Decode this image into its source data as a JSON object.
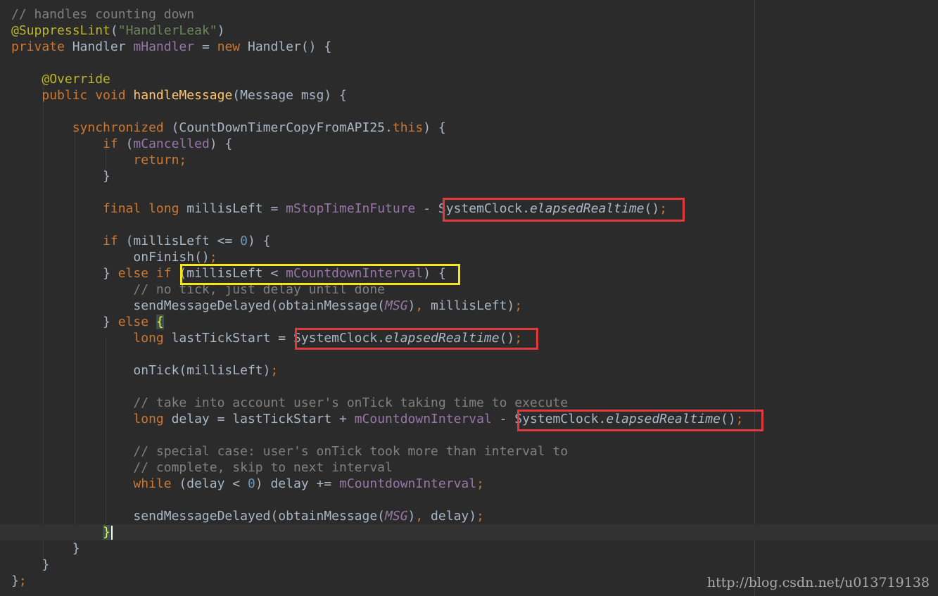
{
  "code_lines": [
    [
      {
        "t": "// handles counting down",
        "c": "comment"
      }
    ],
    [
      {
        "t": "@SuppressLint",
        "c": "annotation"
      },
      {
        "t": "(",
        "c": "plain"
      },
      {
        "t": "\"HandlerLeak\"",
        "c": "string"
      },
      {
        "t": ")",
        "c": "plain"
      }
    ],
    [
      {
        "t": "private",
        "c": "keyword"
      },
      {
        "t": " Handler ",
        "c": "plain"
      },
      {
        "t": "mHandler",
        "c": "field"
      },
      {
        "t": " = ",
        "c": "plain"
      },
      {
        "t": "new",
        "c": "keyword"
      },
      {
        "t": " Handler() {",
        "c": "plain"
      }
    ],
    [],
    [
      {
        "t": "    ",
        "c": "plain"
      },
      {
        "t": "@Override",
        "c": "annotation"
      }
    ],
    [
      {
        "t": "    ",
        "c": "plain"
      },
      {
        "t": "public void ",
        "c": "keyword"
      },
      {
        "t": "handleMessage",
        "c": "method"
      },
      {
        "t": "(Message msg) {",
        "c": "plain"
      }
    ],
    [],
    [
      {
        "t": "        ",
        "c": "plain"
      },
      {
        "t": "synchronized",
        "c": "keyword"
      },
      {
        "t": " (CountDownTimerCopyFromAPI25.",
        "c": "plain"
      },
      {
        "t": "this",
        "c": "keyword"
      },
      {
        "t": ") {",
        "c": "plain"
      }
    ],
    [
      {
        "t": "            ",
        "c": "plain"
      },
      {
        "t": "if",
        "c": "keyword"
      },
      {
        "t": " (",
        "c": "plain"
      },
      {
        "t": "mCancelled",
        "c": "field"
      },
      {
        "t": ") {",
        "c": "plain"
      }
    ],
    [
      {
        "t": "                ",
        "c": "plain"
      },
      {
        "t": "return;",
        "c": "keyword"
      }
    ],
    [
      {
        "t": "            }",
        "c": "plain"
      }
    ],
    [],
    [
      {
        "t": "            ",
        "c": "plain"
      },
      {
        "t": "final long ",
        "c": "keyword"
      },
      {
        "t": "millisLeft = ",
        "c": "plain"
      },
      {
        "t": "mStopTimeInFuture",
        "c": "field"
      },
      {
        "t": " - SystemClock.",
        "c": "plain"
      },
      {
        "t": "elapsedRealtime",
        "c": "italic"
      },
      {
        "t": "()",
        "c": "plain"
      },
      {
        "t": ";",
        "c": "keyword"
      }
    ],
    [],
    [
      {
        "t": "            ",
        "c": "plain"
      },
      {
        "t": "if",
        "c": "keyword"
      },
      {
        "t": " (millisLeft <= ",
        "c": "plain"
      },
      {
        "t": "0",
        "c": "number"
      },
      {
        "t": ") {",
        "c": "plain"
      }
    ],
    [
      {
        "t": "                onFinish()",
        "c": "plain"
      },
      {
        "t": ";",
        "c": "keyword"
      }
    ],
    [
      {
        "t": "            } ",
        "c": "plain"
      },
      {
        "t": "else if",
        "c": "keyword"
      },
      {
        "t": " (millisLeft < ",
        "c": "plain"
      },
      {
        "t": "mCountdownInterval",
        "c": "field"
      },
      {
        "t": ") {",
        "c": "plain"
      }
    ],
    [
      {
        "t": "                ",
        "c": "plain"
      },
      {
        "t": "// no tick, just delay until done",
        "c": "comment"
      }
    ],
    [
      {
        "t": "                sendMessageDelayed(obtainMessage(",
        "c": "plain"
      },
      {
        "t": "MSG",
        "c": "static"
      },
      {
        "t": ")",
        "c": "plain"
      },
      {
        "t": ",",
        "c": "keyword"
      },
      {
        "t": " millisLeft)",
        "c": "plain"
      },
      {
        "t": ";",
        "c": "keyword"
      }
    ],
    [
      {
        "t": "            } ",
        "c": "plain"
      },
      {
        "t": "else",
        "c": "keyword"
      },
      {
        "t": " ",
        "c": "plain"
      },
      {
        "t": "{",
        "c": "brace-match"
      }
    ],
    [
      {
        "t": "                ",
        "c": "plain"
      },
      {
        "t": "long",
        "c": "keyword"
      },
      {
        "t": " lastTickStart = SystemClock.",
        "c": "plain"
      },
      {
        "t": "elapsedRealtime",
        "c": "italic"
      },
      {
        "t": "()",
        "c": "plain"
      },
      {
        "t": ";",
        "c": "keyword"
      }
    ],
    [],
    [
      {
        "t": "                onTick(millisLeft)",
        "c": "plain"
      },
      {
        "t": ";",
        "c": "keyword"
      }
    ],
    [],
    [
      {
        "t": "                ",
        "c": "plain"
      },
      {
        "t": "// take into account user's onTick taking time to execute",
        "c": "comment"
      }
    ],
    [
      {
        "t": "                ",
        "c": "plain"
      },
      {
        "t": "long",
        "c": "keyword"
      },
      {
        "t": " delay = lastTickStart + ",
        "c": "plain"
      },
      {
        "t": "mCountdownInterval",
        "c": "field"
      },
      {
        "t": " - SystemClock.",
        "c": "plain"
      },
      {
        "t": "elapsedRealtime",
        "c": "italic"
      },
      {
        "t": "()",
        "c": "plain"
      },
      {
        "t": ";",
        "c": "keyword"
      }
    ],
    [],
    [
      {
        "t": "                ",
        "c": "plain"
      },
      {
        "t": "// special case: user's onTick took more than interval to",
        "c": "comment"
      }
    ],
    [
      {
        "t": "                ",
        "c": "plain"
      },
      {
        "t": "// complete, skip to next interval",
        "c": "comment"
      }
    ],
    [
      {
        "t": "                ",
        "c": "plain"
      },
      {
        "t": "while",
        "c": "keyword"
      },
      {
        "t": " (delay < ",
        "c": "plain"
      },
      {
        "t": "0",
        "c": "number"
      },
      {
        "t": ") delay += ",
        "c": "plain"
      },
      {
        "t": "mCountdownInterval",
        "c": "field"
      },
      {
        "t": ";",
        "c": "keyword"
      }
    ],
    [],
    [
      {
        "t": "                sendMessageDelayed(obtainMessage(",
        "c": "plain"
      },
      {
        "t": "MSG",
        "c": "static"
      },
      {
        "t": ")",
        "c": "plain"
      },
      {
        "t": ",",
        "c": "keyword"
      },
      {
        "t": " delay)",
        "c": "plain"
      },
      {
        "t": ";",
        "c": "keyword"
      }
    ],
    [
      {
        "t": "            ",
        "c": "plain"
      },
      {
        "t": "}",
        "c": "brace-match"
      },
      {
        "t": "",
        "c": "caret"
      }
    ],
    [
      {
        "t": "        }",
        "c": "plain"
      }
    ],
    [
      {
        "t": "    }",
        "c": "plain"
      }
    ],
    [
      {
        "t": "}",
        "c": "plain"
      },
      {
        "t": ";",
        "c": "keyword"
      }
    ]
  ],
  "caret_line": 32,
  "watermark": "http://blog.csdn.net/u013719138",
  "colors": {
    "background": "#2b2b2b",
    "red_box": "#e0393e",
    "yellow_box": "#f5e51b"
  }
}
